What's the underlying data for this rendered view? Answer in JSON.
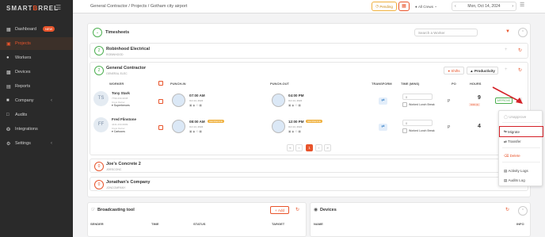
{
  "app": {
    "logo_part1": "SMART",
    "logo_part2": "B",
    "logo_part3": "RREL"
  },
  "sidebar": {
    "items": [
      {
        "label": "Dashboard",
        "icon": "grid-icon",
        "badge": "NEW"
      },
      {
        "label": "Projects",
        "icon": "briefcase-icon"
      },
      {
        "label": "Workers",
        "icon": "user-icon"
      },
      {
        "label": "Devices",
        "icon": "device-icon"
      },
      {
        "label": "Reports",
        "icon": "report-icon"
      },
      {
        "label": "Company",
        "icon": "building-icon"
      },
      {
        "label": "Audits",
        "icon": "audit-icon"
      },
      {
        "label": "Integrations",
        "icon": "plug-icon"
      },
      {
        "label": "Settings",
        "icon": "gear-icon"
      }
    ]
  },
  "header": {
    "breadcrumb": [
      "General Contractor",
      "Projects",
      "Gotham city airport"
    ],
    "pending_label": "Pending",
    "crews_label": "All Crews",
    "date_label": "Mon, Oct 14, 2024"
  },
  "timesheets": {
    "title": "Timesheets",
    "search_placeholder": "Search a Worker"
  },
  "companies": [
    {
      "name": "Robinhood Electrical",
      "sub": "ROBINHOOD",
      "count": "2"
    },
    {
      "name": "General Contractor",
      "sub": "GENERAL ELEC",
      "count": "2"
    },
    {
      "name": "Joe's Concrete 2",
      "sub": "JOESCONC",
      "count": "0"
    },
    {
      "name": "Jonathan's Company",
      "sub": "JONCOMPANY",
      "count": "0"
    }
  ],
  "gc_buttons": {
    "shifts": "Shifts",
    "productivity": "Productivity"
  },
  "columns": {
    "worker": "WORKER",
    "punch_in": "PUNCH-IN",
    "punch_out": "PUNCH-OUT",
    "transform": "TRANSFORM",
    "time": "TIME (MINS)",
    "po": "PO",
    "hours": "HOURS"
  },
  "rows": [
    {
      "initials": "TS",
      "name": "Tony Stark",
      "sub1": "7790-330-9038",
      "sub2": "Crew Owner",
      "crew": "Superheroes",
      "in_time": "07:00 AM",
      "in_date": "Oct 14, 2024",
      "in_tag": "",
      "out_time": "04:00 PM",
      "out_date": "Oct 14, 2024",
      "out_tag": "",
      "lunch": "Worked Lunch Break",
      "po": "P",
      "hours": "9",
      "hours_sub": "9:00 (1)",
      "approve": "APPROVE"
    },
    {
      "initials": "FF",
      "name": "Fred Flinstone",
      "sub1": "4441-333-9999",
      "sub2": "Crew Owner",
      "crew": "Cartoons",
      "in_time": "08:00 AM",
      "in_date": "Oct 14, 2024",
      "in_tag": "GEOFENCE",
      "out_time": "12:00 PM",
      "out_date": "Oct 14, 2024",
      "out_tag": "GEOFENCE",
      "lunch": "Worked Lunch Break",
      "po": "P",
      "hours": "4",
      "hours_sub": "",
      "approve": ""
    }
  ],
  "pagination": {
    "current": "1"
  },
  "menu": {
    "items": [
      {
        "label": "Unapprove",
        "style": "muted"
      },
      {
        "label": "Migrate",
        "style": "highlight"
      },
      {
        "label": "Transfer",
        "style": "normal"
      },
      {
        "label": "Delete",
        "style": "danger"
      },
      {
        "label": "Activity Logs",
        "style": "normal"
      },
      {
        "label": "Audits Log",
        "style": "normal"
      }
    ]
  },
  "broadcast": {
    "title": "Broadcasting tool",
    "add_label": "Add",
    "cols": [
      "SENDER",
      "TIME",
      "STATUS",
      "TARGET"
    ]
  },
  "devices": {
    "title": "Devices",
    "cols": [
      "NAME",
      "INFO"
    ]
  },
  "colors": {
    "accent": "#e8542b",
    "green": "#4caf50",
    "sidebar": "#2a2a2a"
  }
}
